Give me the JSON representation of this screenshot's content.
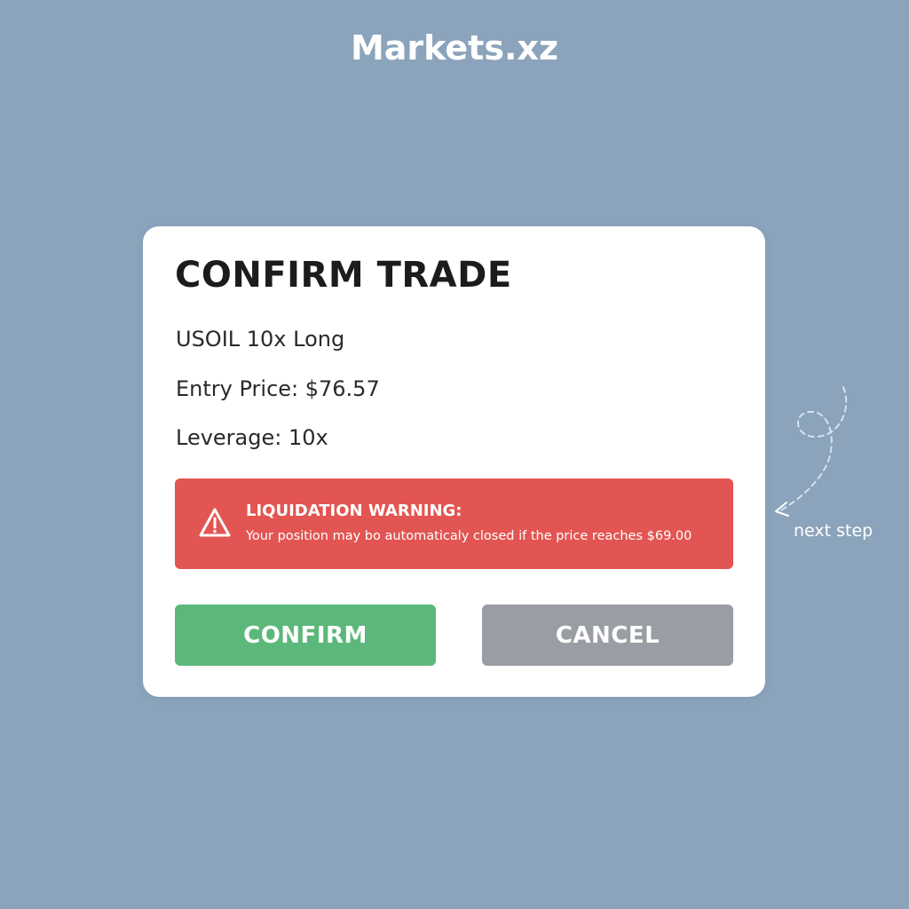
{
  "brand": {
    "title": "Markets.xz"
  },
  "dialog": {
    "title": "CONFIRM TRADE",
    "pair_line": "USOIL 10x Long",
    "entry_price_line": "Entry Price: $76.57",
    "leverage_line": "Leverage: 10x",
    "warning": {
      "icon": "warning-triangle-icon",
      "heading": "LIQUIDATION WARNING:",
      "message": "Your position may bo automaticaly closed if the price reaches $69.00",
      "color": "#e25552"
    },
    "buttons": {
      "confirm_label": "CONFIRM",
      "confirm_color": "#5cb87a",
      "cancel_label": "CANCEL",
      "cancel_color": "#9a9da3"
    }
  },
  "annotation": {
    "icon": "dashed-arrow-icon",
    "label": "next step"
  },
  "colors": {
    "background": "#8ba4bc",
    "dialog_background": "#ffffff"
  }
}
